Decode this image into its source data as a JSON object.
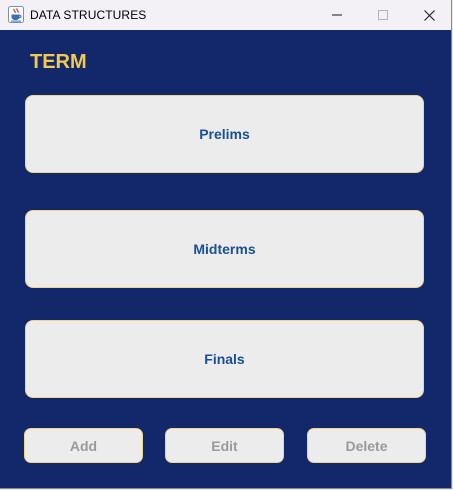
{
  "window": {
    "title": "DATA STRUCTURES",
    "icons": {
      "app": "java-coffee-cup-icon",
      "minimize": "minimize-icon",
      "maximize": "maximize-icon",
      "close": "close-icon"
    }
  },
  "main": {
    "heading": "TERM",
    "terms": [
      {
        "label": "Prelims"
      },
      {
        "label": "Midterms"
      },
      {
        "label": "Finals"
      }
    ]
  },
  "actions": {
    "add_label": "Add",
    "edit_label": "Edit",
    "delete_label": "Delete"
  },
  "colors": {
    "background": "#12286a",
    "heading": "#f7c84b",
    "card_text": "#1a4f94",
    "card_border": "#f0d58a",
    "disabled_text": "#9a9a9a"
  }
}
